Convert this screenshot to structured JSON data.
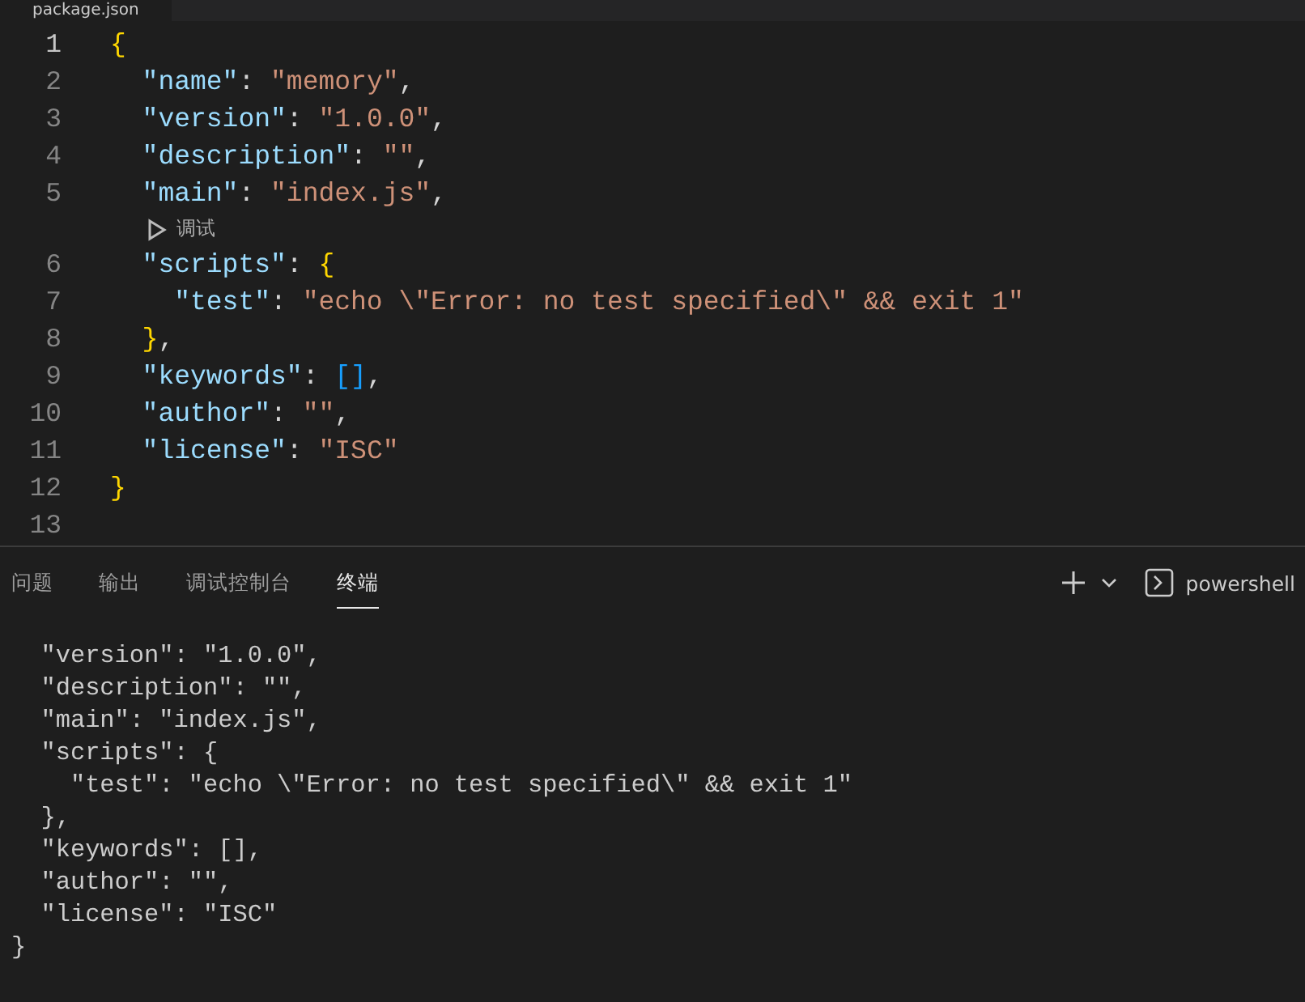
{
  "editor_tab": {
    "label": "package.json"
  },
  "editor": {
    "lines": [
      {
        "kind": "code",
        "number": "1",
        "active": true,
        "tokens": [
          {
            "text": "{",
            "kind": "brace"
          }
        ],
        "children": [
          {
            "kind": "code",
            "number": "2",
            "active": false,
            "tokens": [
              {
                "text": "\"name\"",
                "kind": "key"
              },
              {
                "text": ": ",
                "kind": "punct"
              },
              {
                "text": "\"memory\"",
                "kind": "string"
              },
              {
                "text": ",",
                "kind": "punct"
              }
            ]
          },
          {
            "kind": "code",
            "number": "3",
            "active": false,
            "tokens": [
              {
                "text": "\"version\"",
                "kind": "key"
              },
              {
                "text": ": ",
                "kind": "punct"
              },
              {
                "text": "\"1.0.0\"",
                "kind": "string"
              },
              {
                "text": ",",
                "kind": "punct"
              }
            ]
          },
          {
            "kind": "code",
            "number": "4",
            "active": false,
            "tokens": [
              {
                "text": "\"description\"",
                "kind": "key"
              },
              {
                "text": ": ",
                "kind": "punct"
              },
              {
                "text": "\"\"",
                "kind": "string"
              },
              {
                "text": ",",
                "kind": "punct"
              }
            ]
          },
          {
            "kind": "code",
            "number": "5",
            "active": false,
            "tokens": [
              {
                "text": "\"main\"",
                "kind": "key"
              },
              {
                "text": ": ",
                "kind": "punct"
              },
              {
                "text": "\"index.js\"",
                "kind": "string"
              },
              {
                "text": ",",
                "kind": "punct"
              }
            ]
          },
          {
            "kind": "codelens",
            "label": "调试"
          },
          {
            "kind": "code",
            "number": "6",
            "active": false,
            "tokens": [
              {
                "text": "\"scripts\"",
                "kind": "key"
              },
              {
                "text": ": ",
                "kind": "punct"
              },
              {
                "text": "{",
                "kind": "brace"
              }
            ],
            "children": [
              {
                "kind": "code",
                "number": "7",
                "active": false,
                "tokens": [
                  {
                    "text": "\"test\"",
                    "kind": "key"
                  },
                  {
                    "text": ": ",
                    "kind": "punct"
                  },
                  {
                    "text": "\"echo \\\"Error: no test specified\\\" && exit 1\"",
                    "kind": "string"
                  }
                ]
              }
            ]
          },
          {
            "kind": "code",
            "number": "8",
            "active": false,
            "tokens": [
              {
                "text": "}",
                "kind": "brace"
              },
              {
                "text": ",",
                "kind": "punct"
              }
            ]
          },
          {
            "kind": "code",
            "number": "9",
            "active": false,
            "tokens": [
              {
                "text": "\"keywords\"",
                "kind": "key"
              },
              {
                "text": ": ",
                "kind": "punct"
              },
              {
                "text": "[]",
                "kind": "bracket"
              },
              {
                "text": ",",
                "kind": "punct"
              }
            ]
          },
          {
            "kind": "code",
            "number": "10",
            "active": false,
            "tokens": [
              {
                "text": "\"author\"",
                "kind": "key"
              },
              {
                "text": ": ",
                "kind": "punct"
              },
              {
                "text": "\"\"",
                "kind": "string"
              },
              {
                "text": ",",
                "kind": "punct"
              }
            ]
          },
          {
            "kind": "code",
            "number": "11",
            "active": false,
            "tokens": [
              {
                "text": "\"license\"",
                "kind": "key"
              },
              {
                "text": ": ",
                "kind": "punct"
              },
              {
                "text": "\"ISC\"",
                "kind": "string"
              }
            ]
          }
        ]
      },
      {
        "kind": "code",
        "number": "12",
        "active": false,
        "tokens": [
          {
            "text": "}",
            "kind": "brace"
          }
        ]
      },
      {
        "kind": "code",
        "number": "13",
        "active": false
      }
    ]
  },
  "panel": {
    "tabs": [
      {
        "label": "问题",
        "selected": false
      },
      {
        "label": "输出",
        "selected": false
      },
      {
        "label": "调试控制台",
        "selected": false
      },
      {
        "label": "终端",
        "selected": true
      }
    ],
    "terminal_name": "powershell"
  },
  "terminal": {
    "lines": [
      "  \"version\": \"1.0.0\",",
      "  \"description\": \"\",",
      "  \"main\": \"index.js\",",
      "  \"scripts\": {",
      "    \"test\": \"echo \\\"Error: no test specified\\\" && exit 1\"",
      "  },",
      "  \"keywords\": [],",
      "  \"author\": \"\",",
      "  \"license\": \"ISC\"",
      "}"
    ]
  }
}
